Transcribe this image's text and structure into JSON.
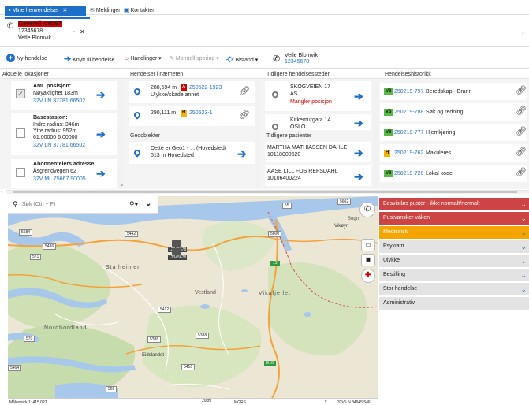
{
  "tabs": [
    {
      "label": "Mine henvendelser",
      "active": true
    },
    {
      "label": "Meldinger",
      "active": false
    },
    {
      "label": "Kontakter",
      "active": false
    }
  ],
  "call_card": {
    "name": "Generell_CR397",
    "phone": "12345678",
    "caller": "Vetle Blomvik"
  },
  "toolbar": {
    "new_incident": "Ny hendelse",
    "link_incident": "Knytt til hendelse",
    "actions": "Handlinger",
    "manual_tracking": "Manuell sporing",
    "assistance": "Bistand",
    "caller_name": "Vetle Blomvik",
    "caller_phone": "12345678"
  },
  "current_locations": {
    "header": "Aktuelle lokasjoner",
    "aml": {
      "title": "AML posisjon:",
      "accuracy": "Nøyaktighet 183m",
      "coords": "32V LN 37781 66502"
    },
    "base_station": {
      "title": "Basestasjon:",
      "inner_radius": "Indre radius: 346m",
      "outer_radius": "Ytre radius: 952m",
      "values": "61,00000 6,00000",
      "coords": "32V LN 37781 66502"
    },
    "subscriber": {
      "title": "Abonnenteiers adresse:",
      "address": "Åsgrendvegen 62",
      "coords": "32V ML 75667 90005"
    }
  },
  "nearby": {
    "header": "Hendelser i nærheten",
    "items": [
      {
        "distance": "288,594 m",
        "badge": "A",
        "id": "250522-1923",
        "desc": "Ulykke/skade annet"
      },
      {
        "distance": "290,111 m",
        "badge": "H",
        "id": "250523-1",
        "desc": ""
      }
    ]
  },
  "geo_objects": {
    "header": "Geoobjekter",
    "items": [
      {
        "name": "Dette er Geo1 - , ,  (Hovedsted)",
        "distance": "513 m Hovedsted"
      }
    ]
  },
  "previous_locations": {
    "header": "Tidligere hendelsessteder",
    "items": [
      {
        "address": "SKOGVEIEN 17",
        "city": "ÅS",
        "note": "Mangler posisjon"
      },
      {
        "address": "Kirkemurgata 14",
        "city": "OSLO",
        "note": ""
      }
    ]
  },
  "previous_patients": {
    "header": "Tidligere pasienter",
    "items": [
      {
        "name": "MARTHA MATHIASSEN DAHLE",
        "id": "10118000620"
      },
      {
        "name": "AASE LILL FOS REFSDAHL",
        "id": "10106400224"
      }
    ]
  },
  "history": {
    "header": "Hendelseshistorikk",
    "items": [
      {
        "badge": "V3",
        "id": "250219-797",
        "desc": "Beredskap - Brann"
      },
      {
        "badge": "V3",
        "id": "250219-788",
        "desc": "Søk og redning"
      },
      {
        "badge": "V3",
        "id": "250219-777",
        "desc": "Hjemkjøring"
      },
      {
        "badge": "H",
        "id": "250219-762",
        "desc": "Makuleres"
      },
      {
        "badge": "V3",
        "id": "250219-720",
        "desc": "Lokal kode"
      }
    ]
  },
  "map": {
    "search_placeholder": "Søk (Ctrl + F)",
    "labels": {
      "stalheimen": "Stalheimen",
      "vestland": "Vestland",
      "vikafjellet": "Vikafjellet",
      "vikoyri": "Vikøyri",
      "sogn": "Sogn",
      "nordhordland": "Nordhordland",
      "eidslandet": "Eidslandet",
      "unit1": "12345678",
      "unit2": "12345678"
    },
    "roads": [
      "5584",
      "5436",
      "5442",
      "5600",
      "13",
      "55",
      "5602",
      "571",
      "5412",
      "5386",
      "5388",
      "570",
      "5464",
      "5410",
      "569",
      "E16"
    ],
    "scale_text": "Målestokk 1: 415 027",
    "scale_km": "20km",
    "coord_system": "MGRS",
    "coord_value": "32V LN 84945 546"
  },
  "categories": [
    {
      "label": "Besvistløs puster - ikke normalt/normalt",
      "color": "#cc4444"
    },
    {
      "label": "Pustvansker våken",
      "color": "#cc4444"
    },
    {
      "label": "Medisinsk",
      "color": "#f5a500"
    },
    {
      "label": "Psykiatri",
      "color": "#e3e3e3"
    },
    {
      "label": "Ulykke",
      "color": "#e3e3e3"
    },
    {
      "label": "Bestilling",
      "color": "#e3e3e3"
    },
    {
      "label": "Stor hendelse",
      "color": "#e3e3e3"
    },
    {
      "label": "Administrativ",
      "color": "#e3e3e3"
    }
  ]
}
